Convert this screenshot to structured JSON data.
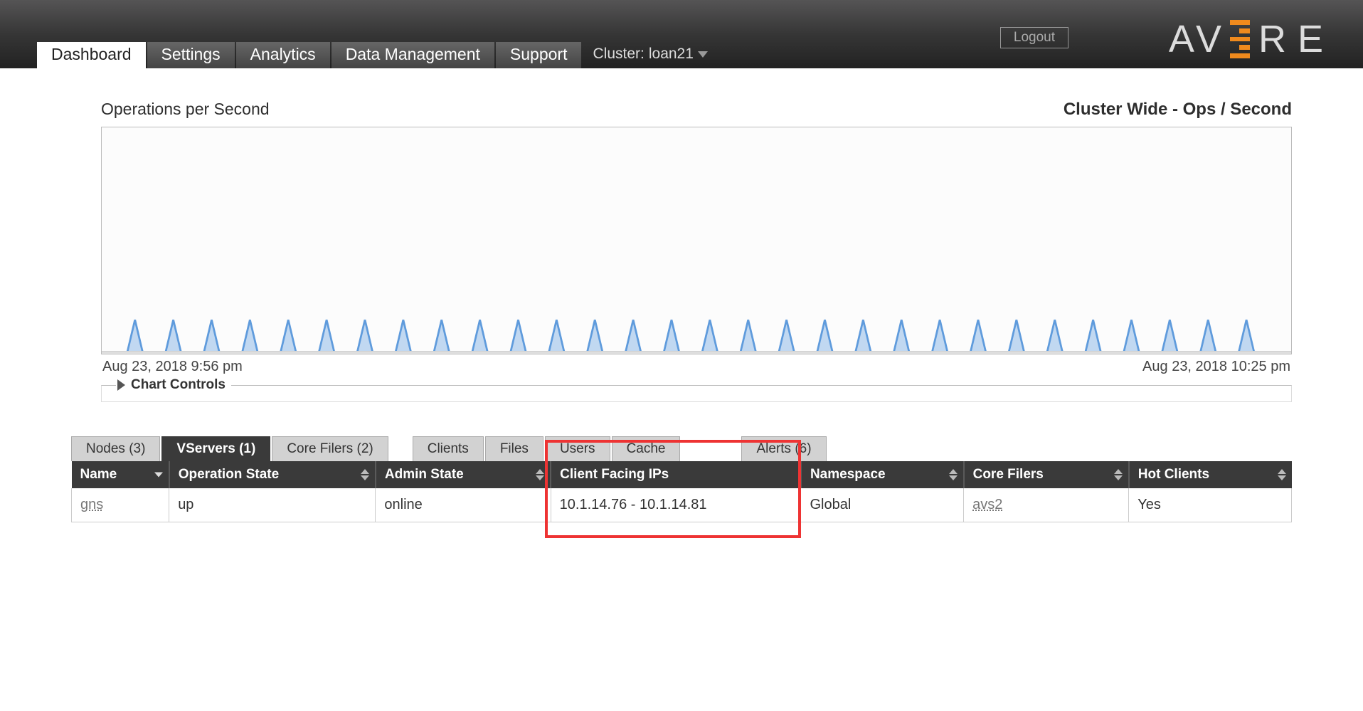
{
  "header": {
    "logout_label": "Logout",
    "tabs": [
      {
        "label": "Dashboard",
        "active": true
      },
      {
        "label": "Settings",
        "active": false
      },
      {
        "label": "Analytics",
        "active": false
      },
      {
        "label": "Data Management",
        "active": false
      },
      {
        "label": "Support",
        "active": false
      }
    ],
    "cluster_prefix": "Cluster: ",
    "cluster_name": "loan21"
  },
  "chart": {
    "title_left": "Operations per Second",
    "title_right": "Cluster Wide - Ops / Second",
    "y_top": "1",
    "y_bottom": "0",
    "x_start": "Aug 23, 2018 9:56 pm",
    "x_end": "Aug 23, 2018 10:25 pm",
    "controls_label": "Chart Controls"
  },
  "chart_data": {
    "type": "line",
    "title": "Operations per Second — Cluster Wide - Ops / Second",
    "xlabel": "",
    "ylabel": "",
    "ylim": [
      0,
      1
    ],
    "x_range": [
      "Aug 23, 2018 9:56 pm",
      "Aug 23, 2018 10:25 pm"
    ],
    "note": "approx. 30 evenly spaced narrow spikes of roughly equal height (~0.15 on 0–1 scale)",
    "series": [
      {
        "name": "ops/sec",
        "spike_count": 30,
        "spike_height_norm": 0.15,
        "baseline_norm": 0
      }
    ]
  },
  "subtabs": {
    "group1": [
      {
        "label": "Nodes (3)",
        "active": false
      },
      {
        "label": "VServers (1)",
        "active": true
      },
      {
        "label": "Core Filers (2)",
        "active": false
      }
    ],
    "group2": [
      {
        "label": "Clients",
        "active": false
      },
      {
        "label": "Files",
        "active": false
      },
      {
        "label": "Users",
        "active": false
      },
      {
        "label": "Cache",
        "active": false
      }
    ],
    "group3": [
      {
        "label": "Alerts (6)",
        "active": false
      }
    ]
  },
  "table": {
    "columns": [
      "Name",
      "Operation State",
      "Admin State",
      "Client Facing IPs",
      "Namespace",
      "Core Filers",
      "Hot Clients"
    ],
    "highlight_col_index": 3,
    "rows": [
      {
        "name": "gns",
        "operation_state": "up",
        "admin_state": "online",
        "client_facing_ips": "10.1.14.76 - 10.1.14.81",
        "namespace": "Global",
        "core_filers": "avs2",
        "hot_clients": "Yes"
      }
    ]
  }
}
